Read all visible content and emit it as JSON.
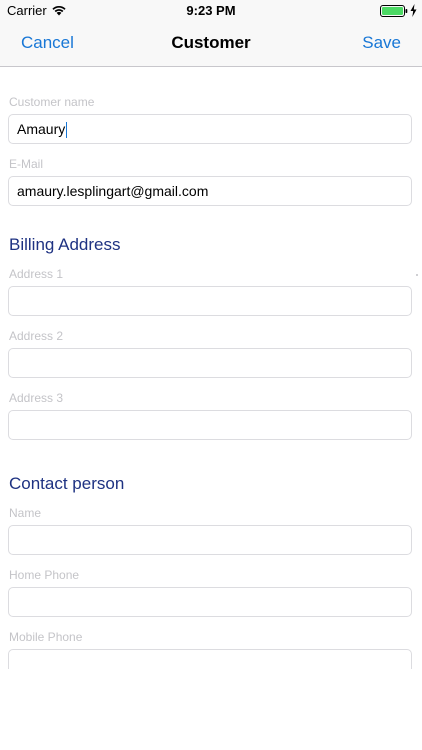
{
  "status_bar": {
    "carrier": "Carrier",
    "time": "9:23 PM",
    "wifi_icon": "wifi-icon",
    "battery_icon": "battery-full-icon",
    "charging_icon": "bolt-icon",
    "battery_color": "#4cd964"
  },
  "nav": {
    "cancel_label": "Cancel",
    "title": "Customer",
    "save_label": "Save",
    "accent_color": "#1877d6"
  },
  "form": {
    "customer_name": {
      "label": "Customer name",
      "value": "Amaury"
    },
    "email": {
      "label": "E-Mail",
      "value": "amaury.lesplingart@gmail.com"
    },
    "billing": {
      "header": "Billing Address",
      "address1": {
        "label": "Address 1",
        "value": ""
      },
      "address2": {
        "label": "Address 2",
        "value": ""
      },
      "address3": {
        "label": "Address 3",
        "value": ""
      }
    },
    "contact": {
      "header": "Contact person",
      "name": {
        "label": "Name",
        "value": ""
      },
      "home_phone": {
        "label": "Home Phone",
        "value": ""
      },
      "mobile_phone": {
        "label": "Mobile Phone",
        "value": ""
      }
    },
    "section_color": "#1e3282"
  }
}
